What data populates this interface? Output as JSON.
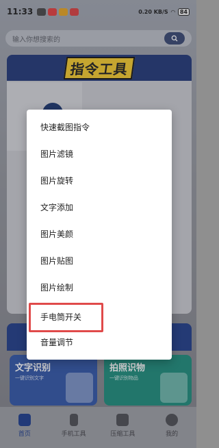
{
  "status_bar": {
    "time": "11:33",
    "network": "0.20 KB/S",
    "battery": "84"
  },
  "search": {
    "placeholder": "输入你想搜索的"
  },
  "banner": {
    "title": "指令工具"
  },
  "tiles": [
    {
      "title": "文字识别",
      "subtitle": "一键识别文字"
    },
    {
      "title": "拍照识物",
      "subtitle": "一键识别物品"
    }
  ],
  "tabbar": [
    {
      "label": "首页",
      "icon": "home-icon",
      "active": true
    },
    {
      "label": "手机工具",
      "icon": "phone-icon",
      "active": false
    },
    {
      "label": "压缩工具",
      "icon": "compress-icon",
      "active": false
    },
    {
      "label": "我的",
      "icon": "person-icon",
      "active": false
    }
  ],
  "menu": {
    "items": [
      "快速截图指令",
      "图片滤镜",
      "图片旋转",
      "文字添加",
      "图片美颜",
      "图片贴图",
      "图片绘制",
      "手电筒开关",
      "音量调节"
    ],
    "highlighted_item": "手电筒开关",
    "highlight_color": "#e04a4a"
  }
}
